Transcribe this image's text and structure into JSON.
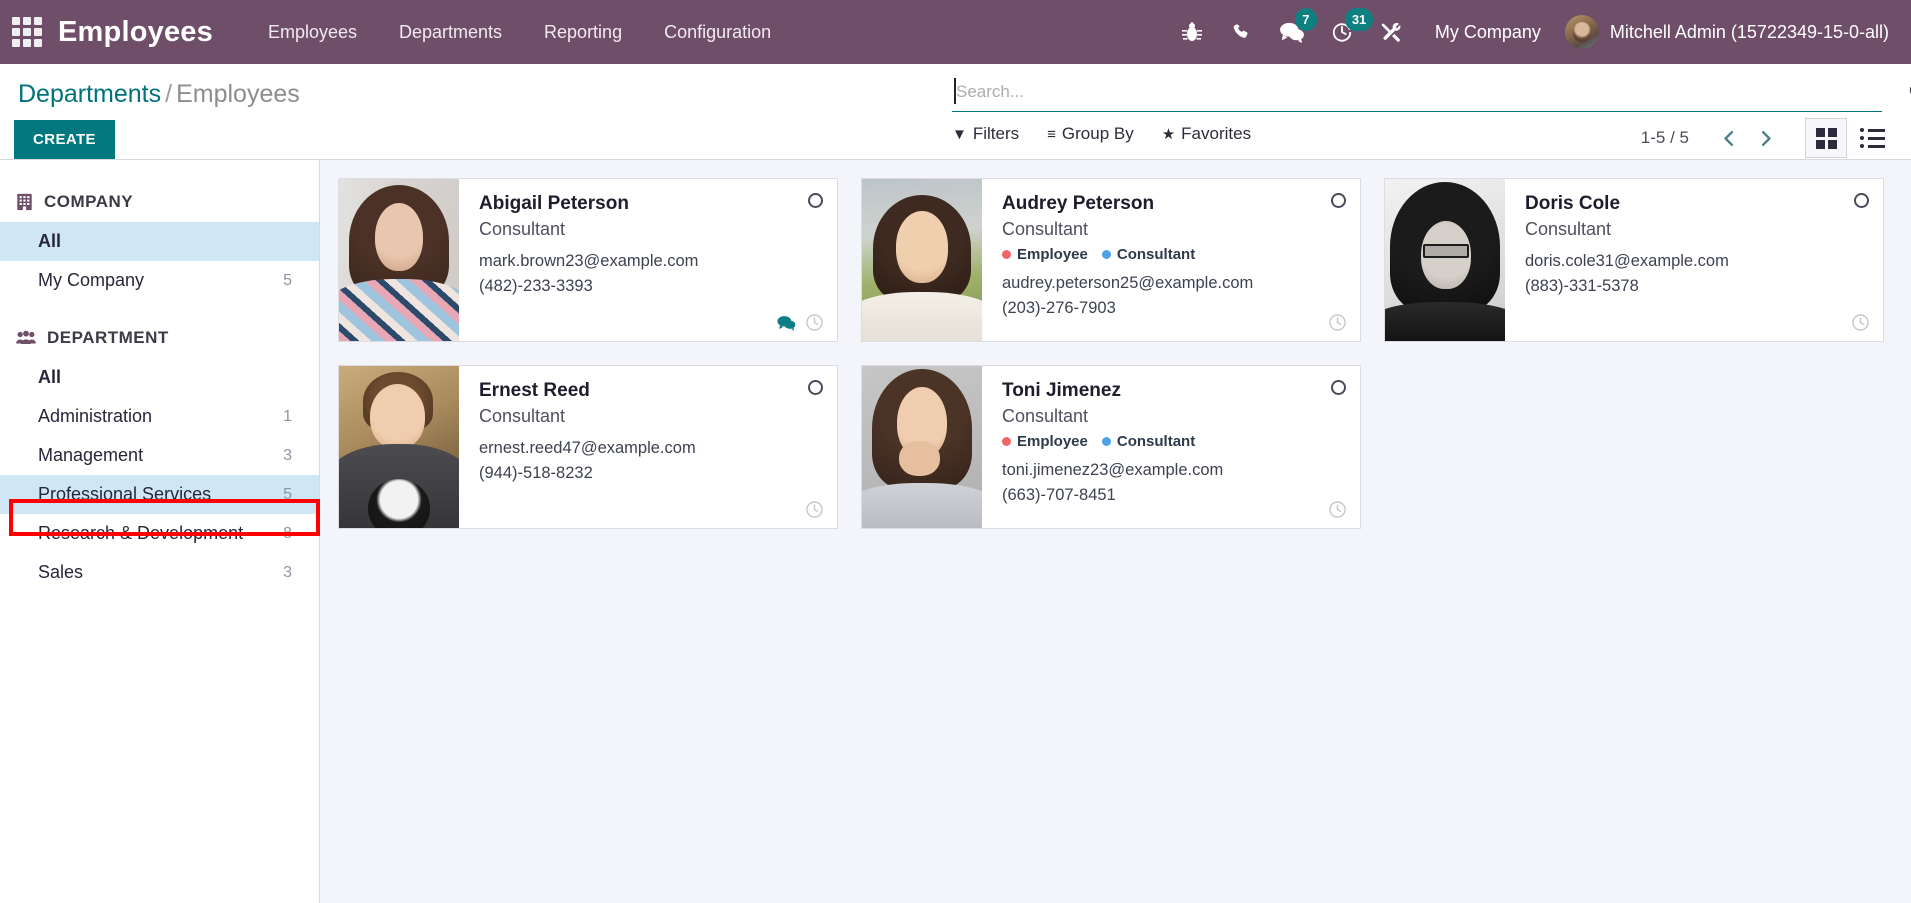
{
  "navbar": {
    "apps_icon": "apps-grid-icon",
    "brand": "Employees",
    "menus": [
      {
        "label": "Employees"
      },
      {
        "label": "Departments"
      },
      {
        "label": "Reporting"
      },
      {
        "label": "Configuration"
      }
    ],
    "sysicons": [
      {
        "name": "bug-icon",
        "badge": ""
      },
      {
        "name": "phone-icon",
        "badge": ""
      },
      {
        "name": "messages-icon",
        "badge": "7"
      },
      {
        "name": "activities-clock-icon",
        "badge": "31"
      },
      {
        "name": "tools-icon",
        "badge": ""
      }
    ],
    "company": "My Company",
    "user": "Mitchell Admin (15722349-15-0-all)",
    "accent_purple": "#6e4e68",
    "badge_color": "#0e8080"
  },
  "control_panel": {
    "breadcrumb": {
      "parent": "Departments",
      "separator": "/",
      "current": "Employees"
    },
    "create_label": "CREATE",
    "search": {
      "value": "",
      "placeholder": "Search..."
    },
    "search_icon": "magnifier-icon",
    "filters": [
      {
        "label": "Filters",
        "icon": "filter-funnel-icon"
      },
      {
        "label": "Group By",
        "icon": "group-lines-icon"
      },
      {
        "label": "Favorites",
        "icon": "star-icon"
      }
    ],
    "pager": {
      "text": "1-5 / 5",
      "prev_icon": "chevron-left-icon",
      "next_icon": "chevron-right-icon"
    },
    "views": [
      {
        "name": "kanban-view",
        "icon": "kanban-grid-icon",
        "active": true
      },
      {
        "name": "list-view",
        "icon": "list-icon",
        "active": false
      }
    ]
  },
  "sidebar": {
    "sections": [
      {
        "title": "COMPANY",
        "icon": "building-icon",
        "items": [
          {
            "label": "All",
            "count": "",
            "selected": true,
            "bold": true
          },
          {
            "label": "My Company",
            "count": "5",
            "selected": false,
            "bold": false
          }
        ]
      },
      {
        "title": "DEPARTMENT",
        "icon": "people-group-icon",
        "items": [
          {
            "label": "All",
            "count": "",
            "selected": false,
            "bold": true
          },
          {
            "label": "Administration",
            "count": "1",
            "selected": false,
            "bold": false
          },
          {
            "label": "Management",
            "count": "3",
            "selected": false,
            "bold": false
          },
          {
            "label": "Professional Services",
            "count": "5",
            "selected": true,
            "bold": false
          },
          {
            "label": "Research & Development",
            "count": "8",
            "selected": false,
            "bold": false
          },
          {
            "label": "Sales",
            "count": "3",
            "selected": false,
            "bold": false
          }
        ]
      }
    ],
    "highlight": {
      "color": "#ff0000",
      "target": "Professional Services"
    }
  },
  "kanban": {
    "tag_colors": {
      "Employee": "#f06666",
      "Consultant": "#4aa3e8"
    },
    "cards": [
      {
        "name": "Abigail Peterson",
        "job": "Consultant",
        "tags": [],
        "email": "mark.brown23@example.com",
        "phone": "(482)-233-3393",
        "footer_icons": [
          "chat-icon",
          "clock-icon"
        ],
        "photo": "woman-curly-dark-hair-floral-top"
      },
      {
        "name": "Audrey Peterson",
        "job": "Consultant",
        "tags": [
          "Employee",
          "Consultant"
        ],
        "email": "audrey.peterson25@example.com",
        "phone": "(203)-276-7903",
        "footer_icons": [
          "clock-icon"
        ],
        "photo": "woman-short-hair-white-sweater-outdoors"
      },
      {
        "name": "Doris Cole",
        "job": "Consultant",
        "tags": [],
        "email": "doris.cole31@example.com",
        "phone": "(883)-331-5378",
        "footer_icons": [
          "clock-icon"
        ],
        "photo": "woman-beanie-glasses-black-and-white"
      },
      {
        "name": "Ernest Reed",
        "job": "Consultant",
        "tags": [],
        "email": "ernest.reed47@example.com",
        "phone": "(944)-518-8232",
        "footer_icons": [
          "clock-icon"
        ],
        "photo": "man-dark-tshirt-smiling"
      },
      {
        "name": "Toni Jimenez",
        "job": "Consultant",
        "tags": [
          "Employee",
          "Consultant"
        ],
        "email": "toni.jimenez23@example.com",
        "phone": "(663)-707-8451",
        "footer_icons": [
          "clock-icon"
        ],
        "photo": "woman-hand-over-mouth-grey-background"
      }
    ]
  }
}
